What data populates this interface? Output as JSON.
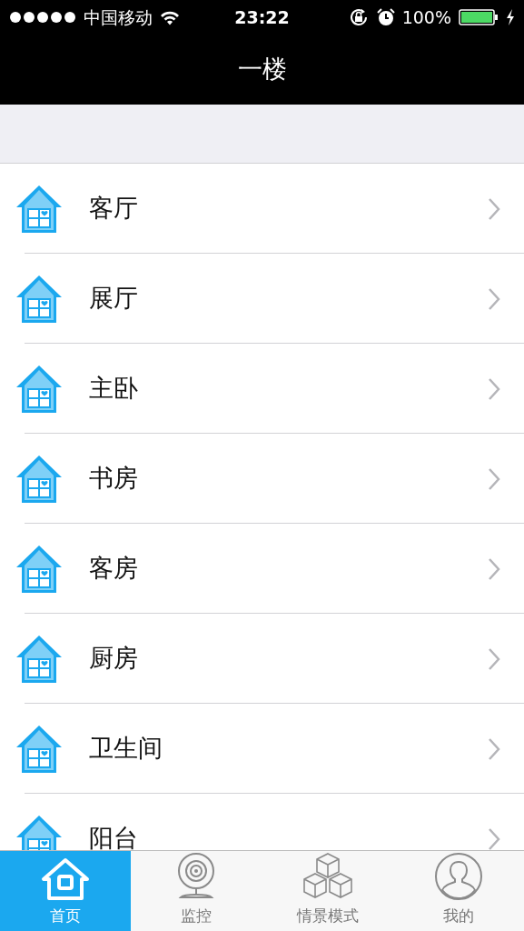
{
  "status_bar": {
    "carrier": "中国移动",
    "time": "23:22",
    "battery": "100%"
  },
  "nav": {
    "title": "一楼"
  },
  "rooms": [
    {
      "label": "客厅"
    },
    {
      "label": "展厅"
    },
    {
      "label": "主卧"
    },
    {
      "label": "书房"
    },
    {
      "label": "客房"
    },
    {
      "label": "厨房"
    },
    {
      "label": "卫生间"
    },
    {
      "label": "阳台"
    }
  ],
  "tabs": [
    {
      "label": "首页",
      "kind": "home",
      "selected": true
    },
    {
      "label": "监控",
      "kind": "camera",
      "selected": false
    },
    {
      "label": "情景模式",
      "kind": "cubes",
      "selected": false
    },
    {
      "label": "我的",
      "kind": "person",
      "selected": false
    }
  ]
}
